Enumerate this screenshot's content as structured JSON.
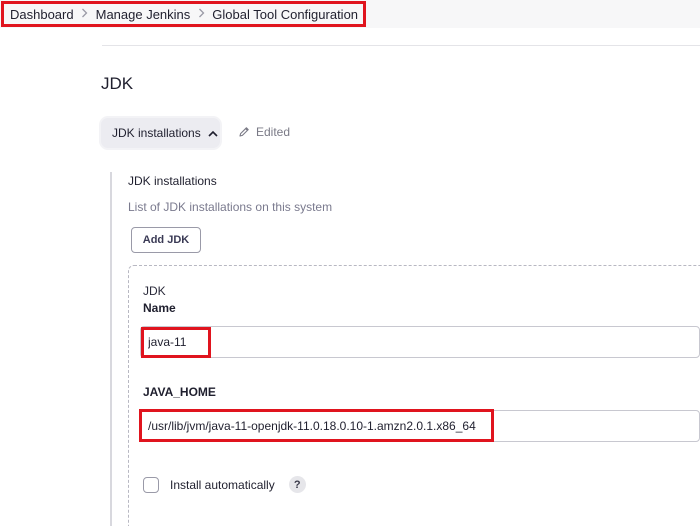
{
  "breadcrumb": {
    "items": [
      "Dashboard",
      "Manage Jenkins",
      "Global Tool Configuration"
    ],
    "separator_icon": "chevron-right-icon"
  },
  "section": {
    "title": "JDK",
    "toggle_label": "JDK installations",
    "toggle_icon": "chevron-up-icon",
    "edited_label": "Edited",
    "edited_icon": "pencil-icon"
  },
  "installations": {
    "title": "JDK installations",
    "description": "List of JDK installations on this system",
    "add_button_label": "Add JDK"
  },
  "jdk": {
    "kind_label": "JDK",
    "name_label": "Name",
    "name_value": "java-11",
    "java_home_label": "JAVA_HOME",
    "java_home_value": "/usr/lib/jvm/java-11-openjdk-11.0.18.0.10-1.amzn2.0.1.x86_64",
    "install_auto_label": "Install automatically",
    "install_auto_checked": false,
    "help_label": "?"
  },
  "colors": {
    "highlight": "#e0141e",
    "muted_text": "#7a7a8e"
  }
}
